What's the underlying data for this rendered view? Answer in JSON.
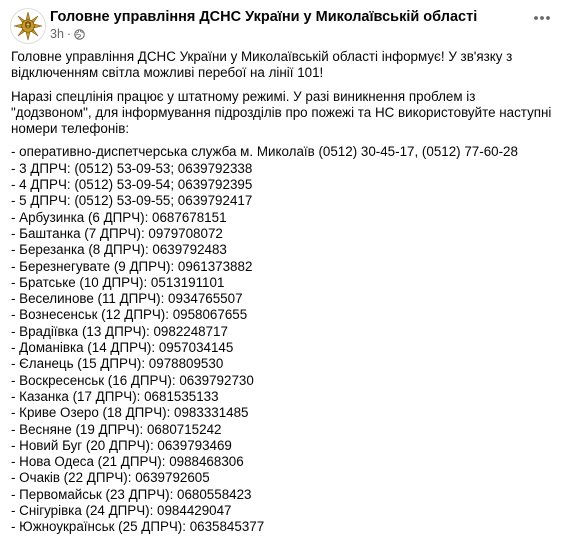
{
  "post": {
    "page_name": "Головне управління ДСНС України у Миколаївській області",
    "time": "3h",
    "separator": "·",
    "more_icon": "ellipsis-icon",
    "privacy_icon": "globe-icon",
    "avatar_icon": "dsns-emblem-icon",
    "colors": {
      "emblem_gold": "#c79a2a",
      "emblem_dark": "#7a5a12",
      "meta_gray": "#65676b"
    },
    "paragraphs": [
      "Головне управління ДСНС України у Миколаївській області інформує! У зв'язку з відключенням світла можливі перебої на лінії 101!",
      "Наразі спецлінія працює у штатному режимі. У разі виникнення проблем із \"додзвоном\", для інформування підрозділів про пожежі та НС використовуйте наступні номери телефонів:"
    ],
    "phones": [
      "- оперативно-диспетчерська служба м. Миколаїв (0512) 30-45-17, (0512) 77-60-28",
      "- 3 ДПРЧ: (0512) 53-09-53; 0639792338",
      "- 4 ДПРЧ: (0512) 53-09-54; 0639792395",
      "- 5 ДПРЧ: (0512) 53-09-55; 0639792417",
      "- Арбузинка (6 ДПРЧ): 0687678151",
      "- Баштанка (7 ДПРЧ): 0979708072",
      "- Березанка (8 ДПРЧ): 0639792483",
      "- Березнегувате (9 ДПРЧ): 0961373882",
      "- Братське (10 ДПРЧ): 0513191101",
      "- Веселинове (11 ДПРЧ): 0934765507",
      "- Вознесенськ (12 ДПРЧ): 0958067655",
      "- Врадіївка (13 ДПРЧ): 0982248717",
      "- Доманівка (14 ДПРЧ): 0957034145",
      "- Єланець (15 ДПРЧ): 0978809530",
      "- Воскресенськ (16 ДПРЧ): 0639792730",
      "- Казанка (17 ДПРЧ): 0681535133",
      "- Криве Озеро (18 ДПРЧ): 0983331485",
      "- Весняне (19 ДПРЧ): 0680715242",
      "- Новий Буг (20 ДПРЧ): 0639793469",
      "- Нова Одеса (21 ДПРЧ): 0988468306",
      "- Очаків (22 ДПРЧ): 0639792605",
      "- Первомайськ (23 ДПРЧ): 0680558423",
      "- Снігурівка (24 ДПРЧ): 0984429047",
      "- Южноукраїнськ (25 ДПРЧ): 0635845377"
    ]
  }
}
